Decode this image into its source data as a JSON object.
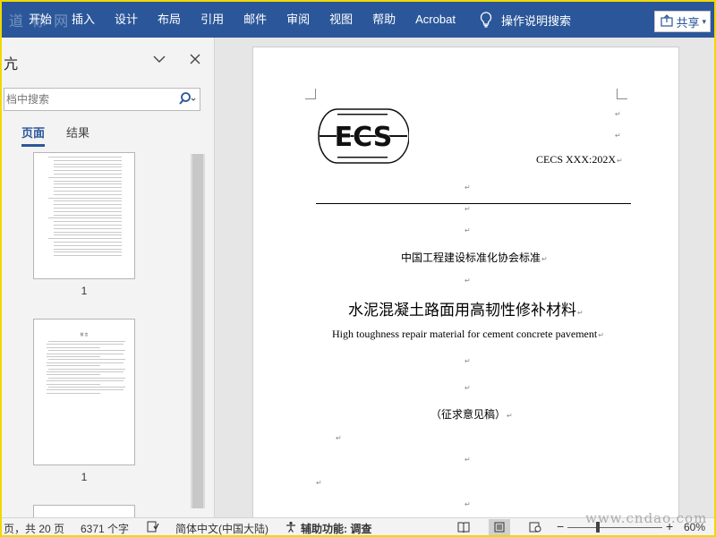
{
  "ribbon": {
    "tabs": [
      "开始",
      "插入",
      "设计",
      "布局",
      "引用",
      "邮件",
      "审阅",
      "视图",
      "帮助",
      "Acrobat"
    ],
    "tell_me": "操作说明搜索",
    "share": "共享",
    "brand_color": "#2b579a"
  },
  "nav_pane": {
    "title": "亢",
    "search_placeholder": "档中搜索",
    "tabs": [
      "页面",
      "结果"
    ],
    "active_tab": "页面",
    "thumbnails": [
      {
        "page_label": "1"
      },
      {
        "page_label": "1",
        "heading": "前 言"
      }
    ]
  },
  "document": {
    "code": "CECS XXX:202X",
    "association": "中国工程建设标准化协会标准",
    "title_cn": "水泥混凝土路面用高韧性修补材料",
    "title_en": "High toughness repair material for cement concrete pavement",
    "status_note": "（征求意见稿）",
    "logo_text": "ECS",
    "paragraph_mark": "↵"
  },
  "status_bar": {
    "page_info": "页，共 20 页",
    "word_count": "6371 个字",
    "language": "简体中文(中国大陆)",
    "accessibility": "辅助功能: 调查",
    "zoom": "60%"
  },
  "watermarks": {
    "top_left": "道 标 网",
    "bottom_right": "www.cndao.com"
  }
}
